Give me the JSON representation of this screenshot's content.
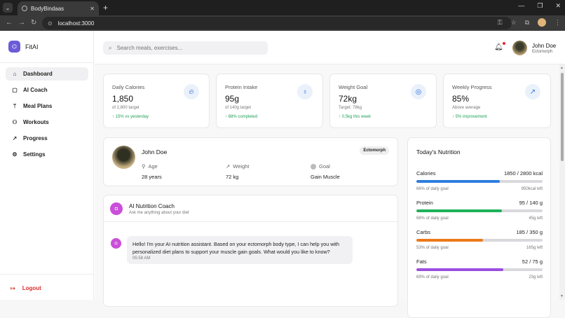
{
  "browser": {
    "tab_title": "BodyBindaas",
    "url": "localhost:3000"
  },
  "app": {
    "brand": "FitAI",
    "nav": [
      {
        "label": "Dashboard",
        "icon": "home-icon",
        "active": true
      },
      {
        "label": "AI Coach",
        "icon": "chat-icon",
        "active": false
      },
      {
        "label": "Meal Plans",
        "icon": "utensils-icon",
        "active": false
      },
      {
        "label": "Workouts",
        "icon": "workout-icon",
        "active": false
      },
      {
        "label": "Progress",
        "icon": "trend-icon",
        "active": false
      },
      {
        "label": "Settings",
        "icon": "gear-icon",
        "active": false
      }
    ],
    "logout": "Logout"
  },
  "header": {
    "search_placeholder": "Search meals, exercises...",
    "user_name": "John Doe",
    "user_type": "Ectomorph"
  },
  "stats": [
    {
      "label": "Daily Calories",
      "value": "1,850",
      "sub": "of 2,800 target",
      "trend": "↑ 15% vs yesterday",
      "icon": "flame-icon"
    },
    {
      "label": "Protein Intake",
      "value": "95g",
      "sub": "of 140g target",
      "trend": "↑ 68% completed",
      "icon": "apple-icon"
    },
    {
      "label": "Weight Goal",
      "value": "72kg",
      "sub": "Target: 78kg",
      "trend": "↑ 0.5kg this week",
      "icon": "target-icon"
    },
    {
      "label": "Weekly Progress",
      "value": "85%",
      "sub": "Above average",
      "trend": "↑ 5% improvement",
      "icon": "trend-up-icon"
    }
  ],
  "profile": {
    "name": "John Doe",
    "badge": "Ectomorph",
    "age_label": "Age",
    "age_value": "28 years",
    "weight_label": "Weight",
    "weight_value": "72 kg",
    "goal_label": "Goal",
    "goal_value": "Gain Muscle"
  },
  "coach": {
    "title": "AI Nutrition Coach",
    "subtitle": "Ask me anything about your diet",
    "message": "Hello! I'm your AI nutrition assistant. Based on your ectomorph body type, I can help you with personalized diet plans to support your muscle gain goals. What would you like to know?",
    "time": "05:58 AM"
  },
  "nutrition": {
    "title": "Today's Nutrition",
    "items": [
      {
        "name": "Calories",
        "amount": "1850 / 2800 kcal",
        "percent_text": "66% of daily goal",
        "left": "950kcal left",
        "fraction": 0.66,
        "color": "#2f7ddf"
      },
      {
        "name": "Protein",
        "amount": "95 / 140 g",
        "percent_text": "68% of daily goal",
        "left": "45g left",
        "fraction": 0.68,
        "color": "#20b15a"
      },
      {
        "name": "Carbs",
        "amount": "185 / 350 g",
        "percent_text": "53% of daily goal",
        "left": "165g left",
        "fraction": 0.53,
        "color": "#ec7a1c"
      },
      {
        "name": "Fats",
        "amount": "52 / 75 g",
        "percent_text": "69% of daily goal",
        "left": "23g left",
        "fraction": 0.69,
        "color": "#9b4fe0"
      }
    ]
  }
}
